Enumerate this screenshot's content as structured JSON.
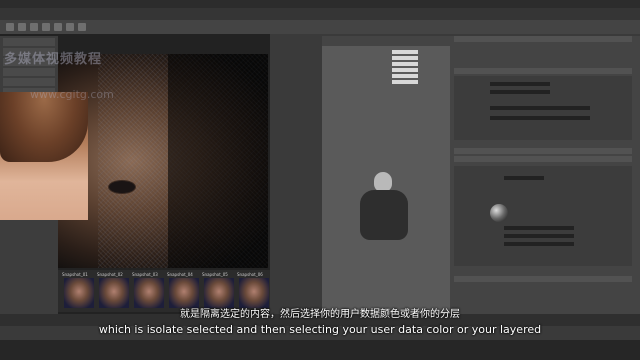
{
  "subtitles": {
    "chinese": "就是隔离选定的内容，然后选择你的用户数据颜色或者你的分层",
    "english": "which is isolate selected and then selecting your user data color or your layered"
  },
  "watermark": {
    "line1": "多媒体视频教程",
    "line2": "www.cgitg.com"
  },
  "thumbnails": [
    {
      "label": "Snapshot_01"
    },
    {
      "label": "Snapshot_02"
    },
    {
      "label": "Snapshot_03"
    },
    {
      "label": "Snapshot_04"
    },
    {
      "label": "Snapshot_05"
    },
    {
      "label": "Snapshot_06"
    }
  ],
  "colors": {
    "ui_dark": "#3a3a3a",
    "panel": "#444444",
    "canvas": "#0d0d0d"
  }
}
